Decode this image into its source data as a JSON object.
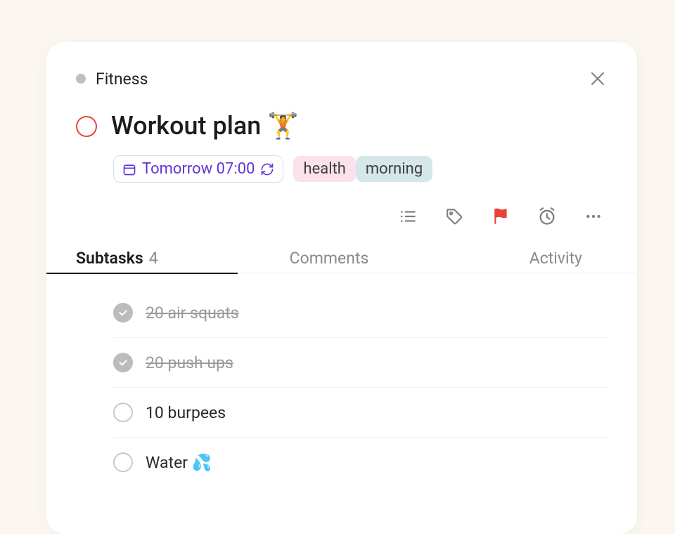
{
  "breadcrumb": {
    "project": "Fitness"
  },
  "task": {
    "title": "Workout plan 🏋️",
    "date_label": "Tomorrow 07:00"
  },
  "tags": [
    {
      "label": "health",
      "variant": "pink"
    },
    {
      "label": "morning",
      "variant": "teal"
    }
  ],
  "tabs": {
    "subtasks_label": "Subtasks",
    "subtasks_count": "4",
    "comments_label": "Comments",
    "activity_label": "Activity"
  },
  "subtasks": [
    {
      "label": "20 air squats",
      "done": true
    },
    {
      "label": "20 push ups",
      "done": true
    },
    {
      "label": "10 burpees",
      "done": false
    },
    {
      "label": "Water 💦",
      "done": false
    }
  ]
}
